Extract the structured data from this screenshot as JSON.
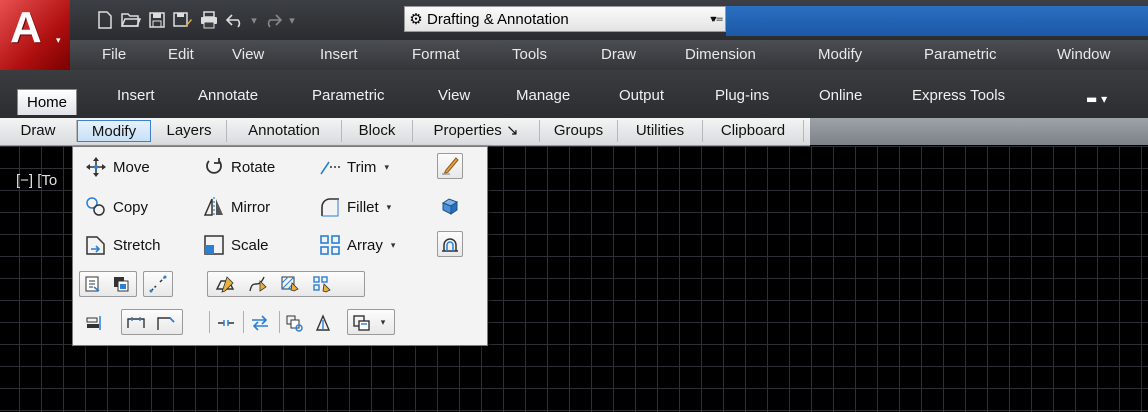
{
  "app": {
    "logo_letter": "A",
    "logo_dropdown": "▾"
  },
  "quick_access": {
    "icons": [
      "new-icon",
      "open-icon",
      "save-icon",
      "save-as-icon",
      "plot-icon",
      "undo-icon",
      "redo-icon"
    ],
    "workspace": {
      "value": "Drafting & Annotation",
      "caret": "▾",
      "more": "▾="
    }
  },
  "menubar": {
    "items": [
      "File",
      "Edit",
      "View",
      "Insert",
      "Format",
      "Tools",
      "Draw",
      "Dimension",
      "Modify",
      "Parametric",
      "Window"
    ]
  },
  "ribbon_tabs": {
    "items": [
      "Home",
      "Insert",
      "Annotate",
      "Parametric",
      "View",
      "Manage",
      "Output",
      "Plug-ins",
      "Online",
      "Express Tools"
    ],
    "active": "Home",
    "extra_icon": "▬ ▾"
  },
  "panels": {
    "items": [
      "Draw",
      "Modify",
      "Layers",
      "Annotation",
      "Block",
      "Properties ↘",
      "Groups",
      "Utilities",
      "Clipboard"
    ],
    "active": "Modify"
  },
  "viewport": {
    "label": "[−] [To"
  },
  "modify_panel": {
    "rows": [
      [
        {
          "label": "Move"
        },
        {
          "label": "Rotate"
        },
        {
          "label": "Trim",
          "dropdown": "▾"
        }
      ],
      [
        {
          "label": "Copy"
        },
        {
          "label": "Mirror"
        },
        {
          "label": "Fillet",
          "dropdown": "▾"
        }
      ],
      [
        {
          "label": "Stretch"
        },
        {
          "label": "Scale"
        },
        {
          "label": "Array",
          "dropdown": "▾"
        }
      ]
    ],
    "side_icons": [
      "erase-icon",
      "explode-icon",
      "offset-icon"
    ],
    "dropdown_arrow": "▾"
  },
  "colors": {
    "accent_blue": "#1c58a6",
    "logo_red": "#c8161e",
    "panel_active_border": "#3e7fcf"
  }
}
